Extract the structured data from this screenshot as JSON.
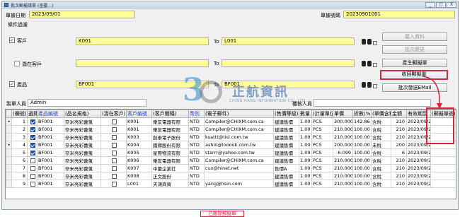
{
  "window": {
    "title": "批次郵擬請單 (查覆...)",
    "controls": [
      "_",
      "□",
      "X"
    ]
  },
  "header": {
    "date_label": "單據日期",
    "date_value": "2023/09/01",
    "no_label": "單據號碼",
    "no_value": "20230901001",
    "filter_label": "條件過濾"
  },
  "filters": [
    {
      "label": "客戶",
      "checked": true,
      "from": "K001",
      "to_label": "To",
      "to": "L001"
    },
    {
      "label": "潛在客戶",
      "checked": false,
      "from": "",
      "to_label": "To",
      "to": ""
    },
    {
      "label": "產品",
      "checked": true,
      "from": "BF001",
      "to_label": "To",
      "to": "BF001"
    }
  ],
  "buttons": {
    "load": "載入資料",
    "batch_change": "批次變更",
    "generate": "產生郵擬單",
    "recall": "收回郵擬單",
    "batch_mail": "批次發送EMail"
  },
  "makers": {
    "maker_label": "製單人員",
    "maker_value": "Admin",
    "modifier_label": "覆核人員",
    "modifier_value": ""
  },
  "watermark": {
    "cn": "正航資訊",
    "en": "CHING HANG INFORMATION CO., LTD."
  },
  "grid": {
    "columns": [
      "(欄號)",
      "選擇",
      "產品編號",
      "(品名規格)",
      "(潛在客戶)",
      "客戶編號",
      "(客戶簡稱)",
      "幣別",
      "(電子郵件)",
      "(售價等級)",
      "數量",
      "(計量單位)",
      "單價",
      "折數(%)",
      "(單價含稅)",
      "金額",
      "有效期至",
      "(郵擬單號)"
    ],
    "blue_columns": [
      2,
      5,
      7
    ],
    "rows": [
      [
        "1",
        true,
        "BF001",
        "奈米亮彩蕾蒐",
        false,
        "K001",
        "樂友電器有限",
        "NTD",
        "Compiler@CHIXM.com.ca",
        "建議售價",
        "1.00",
        "PCS",
        "300.000",
        "142.86",
        "含稅",
        "210",
        "2023/09/21",
        ""
      ],
      [
        "2",
        true,
        "BF001",
        "奈米亮彩蕾蒐",
        false,
        "K001",
        "樂友電器有限",
        "NTD",
        "Compiler@CHIXM.com.ca",
        "建議售價",
        "1.00",
        "PCS",
        "210.000",
        "100.00",
        "含稅",
        "210",
        "2023/09/21",
        ""
      ],
      [
        "3",
        true,
        "BF001",
        "奈米亮彩蕾蒐",
        false,
        "K003",
        "創泰電子股份",
        "NTD",
        "ksattt@tisi.com.tw",
        "建議售價",
        "1.00",
        "PCS",
        "210.000",
        "100.00",
        "含稅",
        "210",
        "2023/09/21",
        ""
      ],
      [
        "4",
        true,
        "BF001",
        "奈米亮彩蕾蒐",
        false,
        "K004",
        "國鄉股份有限",
        "NTD",
        "ashin@looook.com.tw",
        "建議售價",
        "1.00",
        "PCS",
        "200.000",
        "100.00",
        "未稅",
        "200",
        "2023/09/21",
        ""
      ],
      [
        "5",
        true,
        "BF001",
        "奈米亮彩蕾蒐",
        false,
        "K005",
        "星際物流有限",
        "NTD",
        "starrr@yahoo.com.tw",
        "建議售價",
        "1.00",
        "PCS",
        "6.099",
        "100.00",
        "含稅",
        "6",
        "2023/09/21",
        ""
      ],
      [
        "6",
        false,
        "BF001",
        "奈米亮彩蕾蒐",
        false,
        "K006",
        "樂友電器有限",
        "NTD",
        "Compiler@CHIXM.com.ca",
        "建議售價",
        "1.00",
        "PCS",
        "210.000",
        "100.00",
        "含稅",
        "210",
        "2023/09/21",
        ""
      ],
      [
        "7",
        false,
        "BF001",
        "奈米亮彩蕾蒐",
        false,
        "K007",
        "中慶企業社",
        "NTD",
        "cux@hinet.net",
        "售價A",
        "1.00",
        "PCS",
        "210.000",
        "100.00",
        "含稅",
        "210",
        "2023/09/21",
        ""
      ],
      [
        "8",
        false,
        "BF001",
        "奈米亮彩蕾蒐",
        false,
        "K008",
        "正文股份",
        "NTD",
        "",
        "建議售價",
        "1.00",
        "PCS",
        "210.000",
        "100.00",
        "含稅",
        "210",
        "2023/09/21",
        ""
      ],
      [
        "9",
        false,
        "BF001",
        "奈米亮彩蕾蒐",
        false,
        "L001",
        "天鴻商貿",
        "NTD",
        "yang@hsin.com",
        "建議售價",
        "1.00",
        "PCS",
        "210.000",
        "100.00",
        "含稅",
        "210",
        "2023/09/21",
        ""
      ]
    ]
  },
  "annotation": {
    "bottom_label": "已刪除郵擬單"
  },
  "colors": {
    "yellow_field": "#ffff99",
    "highlight_red": "#d0273a",
    "blue_header": "#1a3fd0"
  }
}
